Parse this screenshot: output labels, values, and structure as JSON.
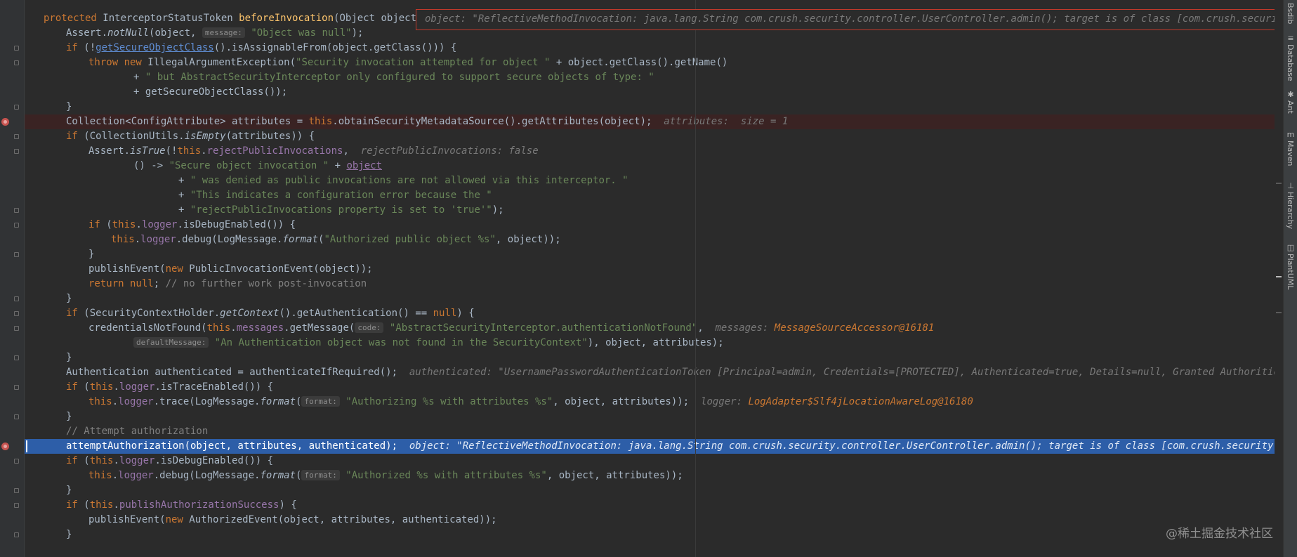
{
  "editor": {
    "lines": [
      {
        "indent": 0,
        "type": "normal",
        "parts": [
          [
            "kw",
            "protected "
          ],
          [
            "",
            "InterceptorStatusToken "
          ],
          [
            "fn",
            "beforeInvocation"
          ],
          [
            "",
            "(Object object) {"
          ]
        ]
      },
      {
        "indent": 1,
        "type": "normal",
        "parts": [
          [
            "",
            "Assert."
          ],
          [
            "it",
            "notNull"
          ],
          [
            "",
            "(object, "
          ],
          [
            "label",
            "message:"
          ],
          [
            "str",
            "\"Object was null\""
          ],
          [
            "",
            ");"
          ]
        ]
      },
      {
        "indent": 1,
        "type": "normal",
        "parts": [
          [
            "kw",
            "if "
          ],
          [
            "",
            "(!"
          ],
          [
            "link",
            "getSecureObjectClass"
          ],
          [
            "",
            "().isAssignableFrom(object.getClass())) {"
          ]
        ]
      },
      {
        "indent": 2,
        "type": "normal",
        "parts": [
          [
            "kw",
            "throw new "
          ],
          [
            "",
            "IllegalArgumentException("
          ],
          [
            "str",
            "\"Security invocation attempted for object \""
          ],
          [
            "",
            " + object.getClass().getName()"
          ]
        ]
      },
      {
        "indent": 4,
        "type": "normal",
        "parts": [
          [
            "",
            "+ "
          ],
          [
            "str",
            "\" but AbstractSecurityInterceptor only configured to support secure objects of type: \""
          ]
        ]
      },
      {
        "indent": 4,
        "type": "normal",
        "parts": [
          [
            "",
            "+ getSecureObjectClass());"
          ]
        ]
      },
      {
        "indent": 1,
        "type": "normal",
        "parts": [
          [
            "",
            "}"
          ]
        ]
      },
      {
        "indent": 1,
        "type": "breakpoint",
        "parts": [
          [
            "",
            "Collection<ConfigAttribute> attributes = "
          ],
          [
            "kw",
            "this"
          ],
          [
            "",
            ".obtainSecurityMetadataSource().getAttributes(object);"
          ],
          [
            "hint",
            "  attributes:  size = 1"
          ]
        ]
      },
      {
        "indent": 1,
        "type": "normal",
        "parts": [
          [
            "kw",
            "if "
          ],
          [
            "",
            "(CollectionUtils."
          ],
          [
            "it",
            "isEmpty"
          ],
          [
            "",
            "(attributes)) {"
          ]
        ]
      },
      {
        "indent": 2,
        "type": "normal",
        "parts": [
          [
            "",
            "Assert."
          ],
          [
            "it",
            "isTrue"
          ],
          [
            "",
            "(!"
          ],
          [
            "kw",
            "this"
          ],
          [
            "",
            "."
          ],
          [
            "fld",
            "rejectPublicInvocations"
          ],
          [
            "",
            ", "
          ],
          [
            "hint",
            " rejectPublicInvocations: false"
          ]
        ]
      },
      {
        "indent": 4,
        "type": "normal",
        "parts": [
          [
            "",
            "() -> "
          ],
          [
            "str",
            "\"Secure object invocation \""
          ],
          [
            "",
            " + "
          ],
          [
            "lnk2",
            "object"
          ]
        ]
      },
      {
        "indent": 6,
        "type": "normal",
        "parts": [
          [
            "",
            "+ "
          ],
          [
            "str",
            "\" was denied as public invocations are not allowed via this interceptor. \""
          ]
        ]
      },
      {
        "indent": 6,
        "type": "normal",
        "parts": [
          [
            "",
            "+ "
          ],
          [
            "str",
            "\"This indicates a configuration error because the \""
          ]
        ]
      },
      {
        "indent": 6,
        "type": "normal",
        "parts": [
          [
            "",
            "+ "
          ],
          [
            "str",
            "\"rejectPublicInvocations property is set to 'true'\""
          ],
          [
            "",
            ");"
          ]
        ]
      },
      {
        "indent": 2,
        "type": "normal",
        "parts": [
          [
            "kw",
            "if "
          ],
          [
            "",
            "("
          ],
          [
            "kw",
            "this"
          ],
          [
            "",
            "."
          ],
          [
            "fld",
            "logger"
          ],
          [
            "",
            ".isDebugEnabled()) {"
          ]
        ]
      },
      {
        "indent": 3,
        "type": "normal",
        "parts": [
          [
            "kw",
            "this"
          ],
          [
            "",
            "."
          ],
          [
            "fld",
            "logger"
          ],
          [
            "",
            ".debug(LogMessage."
          ],
          [
            "it",
            "format"
          ],
          [
            "",
            "("
          ],
          [
            "str",
            "\"Authorized public object %s\""
          ],
          [
            "",
            ", object));"
          ]
        ]
      },
      {
        "indent": 2,
        "type": "normal",
        "parts": [
          [
            "",
            "}"
          ]
        ]
      },
      {
        "indent": 2,
        "type": "normal",
        "parts": [
          [
            "",
            "publishEvent("
          ],
          [
            "kw",
            "new "
          ],
          [
            "",
            "PublicInvocationEvent(object));"
          ]
        ]
      },
      {
        "indent": 2,
        "type": "normal",
        "parts": [
          [
            "kw",
            "return null"
          ],
          [
            "",
            ";"
          ],
          [
            "cmt",
            " // no further work post-invocation"
          ]
        ]
      },
      {
        "indent": 1,
        "type": "normal",
        "parts": [
          [
            "",
            "}"
          ]
        ]
      },
      {
        "indent": 1,
        "type": "normal",
        "parts": [
          [
            "kw",
            "if "
          ],
          [
            "",
            "(SecurityContextHolder."
          ],
          [
            "it",
            "getContext"
          ],
          [
            "",
            "().getAuthentication() == "
          ],
          [
            "kw",
            "null"
          ],
          [
            "",
            ") {"
          ]
        ]
      },
      {
        "indent": 2,
        "type": "normal",
        "parts": [
          [
            "",
            "credentialsNotFound("
          ],
          [
            "kw",
            "this"
          ],
          [
            "",
            "."
          ],
          [
            "fld",
            "messages"
          ],
          [
            "",
            ".getMessage("
          ],
          [
            "label",
            "code:"
          ],
          [
            "str",
            "\"AbstractSecurityInterceptor.authenticationNotFound\""
          ],
          [
            "",
            ", "
          ],
          [
            "hint",
            " messages: "
          ],
          [
            "hintv",
            "MessageSourceAccessor@16181"
          ]
        ]
      },
      {
        "indent": 4,
        "type": "normal",
        "parts": [
          [
            "label",
            "defaultMessage:"
          ],
          [
            "str",
            "\"An Authentication object was not found in the SecurityContext\""
          ],
          [
            "",
            "), object, attributes);"
          ]
        ]
      },
      {
        "indent": 1,
        "type": "normal",
        "parts": [
          [
            "",
            "}"
          ]
        ]
      },
      {
        "indent": 1,
        "type": "normal",
        "parts": [
          [
            "",
            "Authentication authenticated = authenticateIfRequired();"
          ],
          [
            "hint",
            "  authenticated: \"UsernamePasswordAuthenticationToken [Principal=admin, Credentials=[PROTECTED], Authenticated=true, Details=null, Granted Authorities=[sys:updat"
          ]
        ]
      },
      {
        "indent": 1,
        "type": "normal",
        "parts": [
          [
            "kw",
            "if "
          ],
          [
            "",
            "("
          ],
          [
            "kw",
            "this"
          ],
          [
            "",
            "."
          ],
          [
            "fld",
            "logger"
          ],
          [
            "",
            ".isTraceEnabled()) {"
          ]
        ]
      },
      {
        "indent": 2,
        "type": "normal",
        "parts": [
          [
            "kw",
            "this"
          ],
          [
            "",
            "."
          ],
          [
            "fld",
            "logger"
          ],
          [
            "",
            ".trace(LogMessage."
          ],
          [
            "it",
            "format"
          ],
          [
            "",
            "("
          ],
          [
            "label",
            "format:"
          ],
          [
            "str",
            "\"Authorizing %s with attributes %s\""
          ],
          [
            "",
            ", object, attributes));"
          ],
          [
            "hint",
            "  logger: "
          ],
          [
            "hintv",
            "LogAdapter$Slf4jLocationAwareLog@16180"
          ]
        ]
      },
      {
        "indent": 1,
        "type": "normal",
        "parts": [
          [
            "",
            "}"
          ]
        ]
      },
      {
        "indent": 1,
        "type": "normal",
        "parts": [
          [
            "cmt",
            "// Attempt authorization"
          ]
        ]
      },
      {
        "indent": 1,
        "type": "exec",
        "parts": [
          [
            "",
            "attemptAuthorization(object, attributes, authenticated);"
          ],
          [
            "hint",
            "  object: \"ReflectiveMethodInvocation: java.lang.String com.crush.security.controller.UserController.admin(); target is of class [com.crush.security.controller.U"
          ]
        ]
      },
      {
        "indent": 1,
        "type": "normal",
        "parts": [
          [
            "kw",
            "if "
          ],
          [
            "",
            "("
          ],
          [
            "kw",
            "this"
          ],
          [
            "",
            "."
          ],
          [
            "fld",
            "logger"
          ],
          [
            "",
            ".isDebugEnabled()) {"
          ]
        ]
      },
      {
        "indent": 2,
        "type": "normal",
        "parts": [
          [
            "kw",
            "this"
          ],
          [
            "",
            "."
          ],
          [
            "fld",
            "logger"
          ],
          [
            "",
            ".debug(LogMessage."
          ],
          [
            "it",
            "format"
          ],
          [
            "",
            "("
          ],
          [
            "label",
            "format:"
          ],
          [
            "str",
            "\"Authorized %s with attributes %s\""
          ],
          [
            "",
            ", object, attributes));"
          ]
        ]
      },
      {
        "indent": 1,
        "type": "normal",
        "parts": [
          [
            "",
            "}"
          ]
        ]
      },
      {
        "indent": 1,
        "type": "normal",
        "parts": [
          [
            "kw",
            "if "
          ],
          [
            "",
            "("
          ],
          [
            "kw",
            "this"
          ],
          [
            "",
            "."
          ],
          [
            "fld",
            "publishAuthorizationSuccess"
          ],
          [
            "",
            ") {"
          ]
        ]
      },
      {
        "indent": 2,
        "type": "normal",
        "parts": [
          [
            "",
            "publishEvent("
          ],
          [
            "kw",
            "new "
          ],
          [
            "",
            "AuthorizedEvent(object, attributes, authenticated));"
          ]
        ]
      },
      {
        "indent": 1,
        "type": "normal",
        "parts": [
          [
            "",
            "}"
          ]
        ]
      }
    ]
  },
  "debug_popup": {
    "text": "object: \"ReflectiveMethodInvocation: java.lang.String com.crush.security.controller.UserController.admin(); target is of class [com.crush.security.contro"
  },
  "sidebar": {
    "tabs": [
      {
        "label": "Database",
        "icon": "database-icon",
        "glyph": "≡"
      },
      {
        "label": "Ant",
        "icon": "ant-icon",
        "glyph": "✱"
      },
      {
        "label": "Maven",
        "icon": "maven-icon",
        "glyph": "m"
      },
      {
        "label": "Hierarchy",
        "icon": "hierarchy-icon",
        "glyph": "⊥"
      },
      {
        "label": "PlantUML",
        "icon": "plantuml-icon",
        "glyph": "◫"
      }
    ],
    "top_label": "Bsdib"
  },
  "watermark": "@稀土掘金技术社区",
  "colors": {
    "background": "#2b2b2b",
    "keyword": "#cc7832",
    "string": "#6a8759",
    "field": "#9876aa",
    "method_decl": "#ffc66d",
    "execution_line": "#2d5ea8",
    "breakpoint_line": "#3a2323",
    "breakpoint": "#c75450",
    "popup_border": "#c0392b"
  }
}
